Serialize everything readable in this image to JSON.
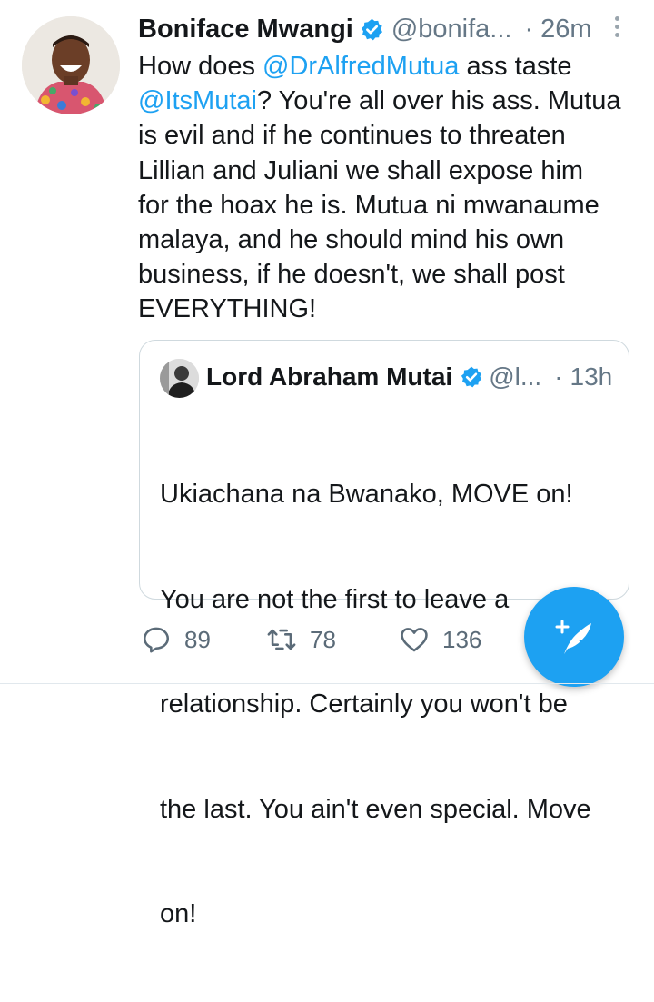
{
  "tweet": {
    "author_name": "Boniface Mwangi",
    "handle": "@bonifa...",
    "separator": "·",
    "time": "26m",
    "text_lines": [
      [
        {
          "t": "How does "
        },
        {
          "t": "@DrAlfredMutua",
          "m": true
        },
        {
          "t": " ass taste"
        }
      ],
      [
        {
          "t": "@ItsMutai",
          "m": true
        },
        {
          "t": "? You're all over his ass. Mutua"
        }
      ],
      [
        {
          "t": "is evil and if he continues to threaten"
        }
      ],
      [
        {
          "t": "Lillian and Juliani we shall expose him"
        }
      ],
      [
        {
          "t": "for the hoax he is. Mutua ni mwanaume"
        }
      ],
      [
        {
          "t": "malaya, and he should mind his own"
        }
      ],
      [
        {
          "t": "business, if he doesn't, we shall post"
        }
      ],
      [
        {
          "t": "EVERYTHING!"
        }
      ]
    ]
  },
  "quoted": {
    "author_name": "Lord Abraham Mutai",
    "handle": "@l...",
    "separator": "·",
    "time": "13h",
    "text_lines": [
      "Ukiachana na Bwanako, MOVE on!",
      "You are not the first to leave a",
      "relationship. Certainly you won't be",
      "the last. You ain't even special. Move",
      "on!"
    ]
  },
  "actions": {
    "replies": "89",
    "retweets": "78",
    "likes": "136"
  },
  "colors": {
    "accent": "#1da1f2",
    "secondary_text": "#657786",
    "border": "#cfd9de"
  },
  "icons": [
    "verified-badge-icon",
    "more-options-icon",
    "reply-icon",
    "retweet-icon",
    "like-icon",
    "compose-tweet-icon"
  ]
}
